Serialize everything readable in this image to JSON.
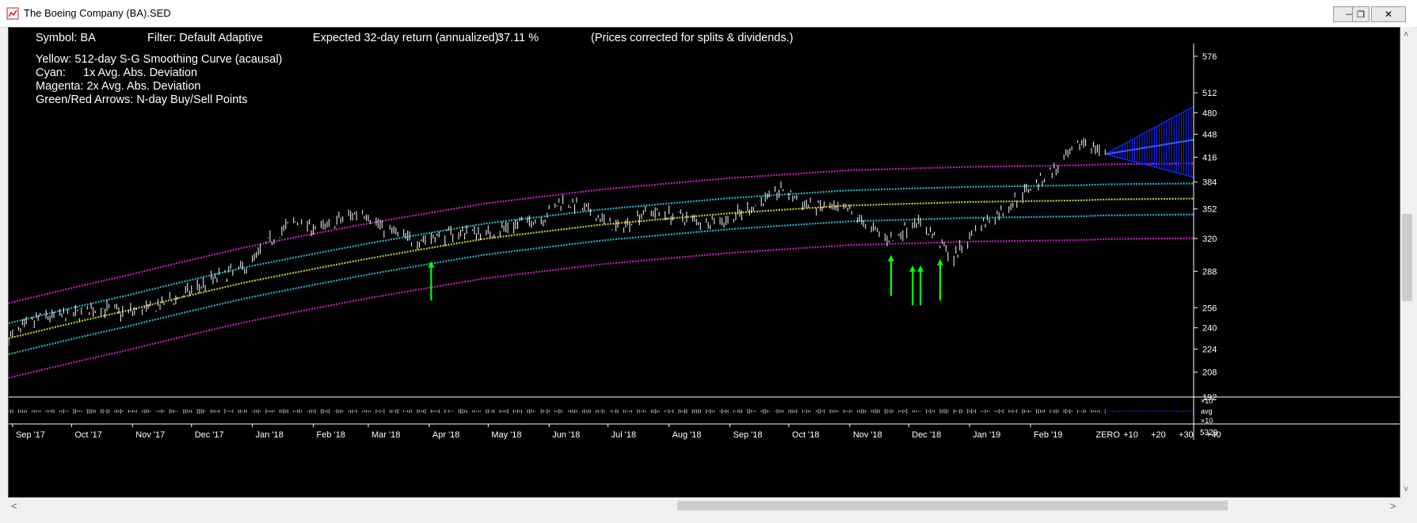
{
  "window": {
    "title": "The Boeing Company (BA).SED",
    "minimize_glyph": "—",
    "restore_glyph": "❐",
    "close_glyph": "✕"
  },
  "header": {
    "symbol": "Symbol: BA",
    "filter": "Filter: Default Adaptive",
    "expected_return_label": "Expected 32-day return (annualized):",
    "expected_return_value": "37.11 %",
    "note": "(Prices corrected for splits & dividends.)"
  },
  "legend": {
    "yellow": "Yellow: 512-day S-G Smoothing Curve (acausal)",
    "cyan_key": "Cyan:",
    "cyan_value": "1x Avg. Abs. Deviation",
    "magenta": "Magenta: 2x Avg. Abs. Deviation",
    "arrows": "Green/Red Arrows: N-day Buy/Sell Points"
  },
  "scrollbars": {
    "left_arrow": "<",
    "right_arrow": ">",
    "up_arrow": "˄",
    "down_arrow": "˅"
  },
  "colors": {
    "background": "#000000",
    "smoothing": "#c8c832",
    "band1x": "#22b8c0",
    "band2x": "#c020c0",
    "price": "#e6e6e6",
    "buy_arrow": "#00ff00",
    "forecast": "#1428ff"
  },
  "chart_data": {
    "type": "line",
    "title": "",
    "y_scale": "log",
    "ylim": [
      192,
      600
    ],
    "y_ticks": [
      192,
      208,
      224,
      240,
      256,
      288,
      320,
      352,
      384,
      416,
      448,
      480,
      512,
      576
    ],
    "x_months": [
      "Sep '17",
      "Oct '17",
      "Nov '17",
      "Dec '17",
      "Jan '18",
      "Feb '18",
      "Mar '18",
      "Apr '18",
      "May '18",
      "Jun '18",
      "Jul '18",
      "Aug '18",
      "Sep '18",
      "Oct '18",
      "Nov '18",
      "Dec '18",
      "Jan '19",
      "Feb '19"
    ],
    "x_forecast_ticks": [
      "ZERO",
      "+10",
      "+20",
      "+30",
      "+40"
    ],
    "volume_axis_labels": [
      "×10",
      "avg",
      "×10"
    ],
    "volume_scale_label": "5329",
    "price_series": {
      "name": "BA",
      "points": [
        [
          "2017-08-30",
          232
        ],
        [
          "2017-09-15",
          248
        ],
        [
          "2017-10-02",
          250
        ],
        [
          "2017-10-16",
          256
        ],
        [
          "2017-10-27",
          252
        ],
        [
          "2017-11-10",
          255
        ],
        [
          "2017-11-24",
          264
        ],
        [
          "2017-12-11",
          280
        ],
        [
          "2017-12-29",
          292
        ],
        [
          "2018-01-10",
          318
        ],
        [
          "2018-01-22",
          338
        ],
        [
          "2018-02-05",
          330
        ],
        [
          "2018-02-15",
          340
        ],
        [
          "2018-02-26",
          350
        ],
        [
          "2018-03-08",
          332
        ],
        [
          "2018-03-23",
          318
        ],
        [
          "2018-04-05",
          322
        ],
        [
          "2018-04-20",
          328
        ],
        [
          "2018-05-01",
          325
        ],
        [
          "2018-05-15",
          335
        ],
        [
          "2018-05-29",
          342
        ],
        [
          "2018-06-08",
          362
        ],
        [
          "2018-06-22",
          348
        ],
        [
          "2018-07-06",
          330
        ],
        [
          "2018-07-20",
          350
        ],
        [
          "2018-08-03",
          345
        ],
        [
          "2018-08-17",
          338
        ],
        [
          "2018-08-31",
          340
        ],
        [
          "2018-09-14",
          356
        ],
        [
          "2018-09-28",
          375
        ],
        [
          "2018-10-08",
          358
        ],
        [
          "2018-10-22",
          352
        ],
        [
          "2018-11-02",
          348
        ],
        [
          "2018-11-12",
          330
        ],
        [
          "2018-11-23",
          318
        ],
        [
          "2018-12-04",
          340
        ],
        [
          "2018-12-14",
          322
        ],
        [
          "2018-12-24",
          300
        ],
        [
          "2019-01-04",
          330
        ],
        [
          "2019-01-18",
          350
        ],
        [
          "2019-02-01",
          378
        ],
        [
          "2019-02-15",
          402
        ],
        [
          "2019-03-01",
          440
        ],
        [
          "2019-03-05",
          430
        ],
        [
          "2019-03-11",
          420
        ]
      ]
    },
    "smoothing_curve": {
      "name": "512-day S-G Smoothing Curve (acausal)",
      "points": [
        [
          "2017-08-30",
          232
        ],
        [
          "2017-10-30",
          254
        ],
        [
          "2017-12-29",
          278
        ],
        [
          "2018-03-01",
          300
        ],
        [
          "2018-04-30",
          320
        ],
        [
          "2018-06-29",
          335
        ],
        [
          "2018-08-31",
          347
        ],
        [
          "2018-10-31",
          356
        ],
        [
          "2018-12-31",
          360
        ],
        [
          "2019-02-28",
          362
        ],
        [
          "2019-03-11",
          363
        ],
        [
          "2019-04-25",
          364
        ]
      ]
    },
    "deviation_bands": {
      "one_x_offset_pct": 5.0,
      "two_x_offset_pct": 12.0
    },
    "forecast": {
      "start": "2019-03-11",
      "end": "2019-04-25",
      "start_value": 420,
      "center_end_value": 440,
      "upper_end_value": 490,
      "lower_end_value": 390
    },
    "buy_points": [
      {
        "date": "2018-04-02",
        "low": 262,
        "high": 296
      },
      {
        "date": "2018-11-22",
        "low": 266,
        "high": 302
      },
      {
        "date": "2018-12-03",
        "low": 258,
        "high": 292
      },
      {
        "date": "2018-12-07",
        "low": 258,
        "high": 292
      },
      {
        "date": "2018-12-17",
        "low": 262,
        "high": 298
      }
    ]
  }
}
